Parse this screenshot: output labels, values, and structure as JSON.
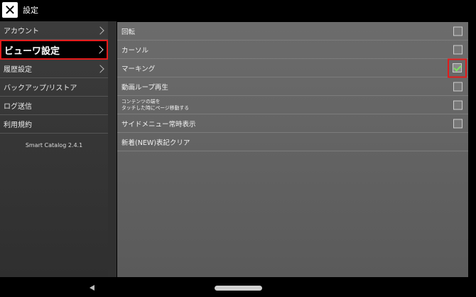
{
  "titlebar": {
    "title": "設定",
    "close_icon": "close-icon"
  },
  "sidebar": {
    "items": [
      {
        "label": "アカウント",
        "has_chevron": true
      },
      {
        "label": "ビューワ設定",
        "has_chevron": true,
        "selected": true
      },
      {
        "label": "履歴設定",
        "has_chevron": true
      },
      {
        "label": "バックアップ/リストア",
        "has_chevron": false
      },
      {
        "label": "ログ送信",
        "has_chevron": false
      },
      {
        "label": "利用規約",
        "has_chevron": false
      }
    ],
    "version": "Smart Catalog 2.4.1"
  },
  "settings": {
    "rows": [
      {
        "label": "回転",
        "checked": false
      },
      {
        "label": "カーソル",
        "checked": false
      },
      {
        "label": "マーキング",
        "checked": true,
        "highlighted": true
      },
      {
        "label": "動画ループ再生",
        "checked": false
      },
      {
        "label_line1": "コンテンツの端を",
        "label_line2": "タッチした時にページ移動する",
        "checked": false
      },
      {
        "label": "サイドメニュー常時表示",
        "checked": false
      },
      {
        "label": "新着(NEW)表記クリア"
      }
    ]
  },
  "colors": {
    "highlight": "#e31b1b",
    "check": "#7be35e"
  }
}
